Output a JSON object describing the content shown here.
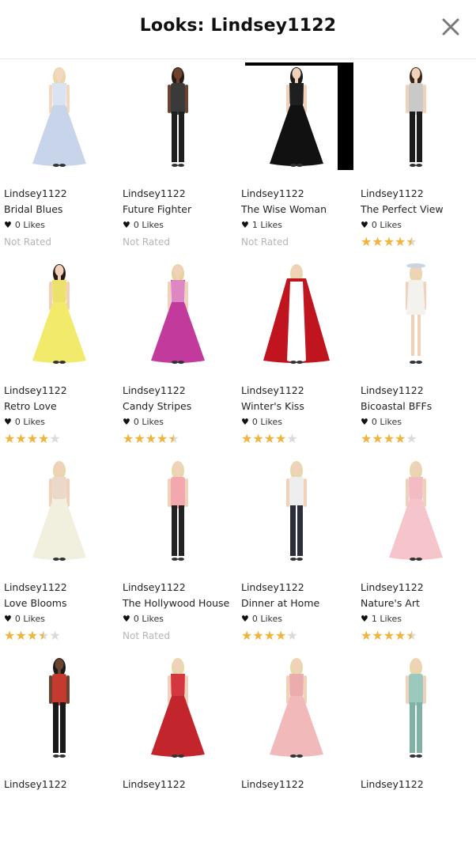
{
  "header": {
    "title": "Looks: Lindsey1122"
  },
  "looks": [
    {
      "user": "Lindsey1122",
      "name": "Bridal Blues",
      "likes": "0 Likes",
      "rating_text": "Not Rated",
      "stars": null,
      "outfit": {
        "dress": "#c8d4ea",
        "accent": "#e9eef8",
        "skin": "#f3d7c0",
        "hair": "#e9d8a6",
        "style": "gown"
      }
    },
    {
      "user": "Lindsey1122",
      "name": "Future Fighter",
      "likes": "0 Likes",
      "rating_text": "Not Rated",
      "stars": null,
      "outfit": {
        "dress": "#1f1f1f",
        "accent": "#3a3a3a",
        "skin": "#6b4330",
        "hair": "#2a1a12",
        "style": "pants"
      }
    },
    {
      "user": "Lindsey1122",
      "name": "The Wise Woman",
      "likes": "1 Likes",
      "rating_text": "Not Rated",
      "stars": null,
      "outfit": {
        "dress": "#111111",
        "accent": "#2b2b2b",
        "skin": "#f0d2bb",
        "hair": "#1b1b1b",
        "style": "gown"
      }
    },
    {
      "user": "Lindsey1122",
      "name": "The Perfect View",
      "likes": "0 Likes",
      "rating_text": "",
      "stars": 4.5,
      "outfit": {
        "dress": "#1c1c1c",
        "accent": "#c9c9c9",
        "skin": "#f0d2bb",
        "hair": "#3a2417",
        "style": "pants"
      }
    },
    {
      "user": "Lindsey1122",
      "name": "Retro Love",
      "likes": "0 Likes",
      "rating_text": "",
      "stars": 4,
      "outfit": {
        "dress": "#f2ea6a",
        "accent": "#e8d86a",
        "skin": "#f0d2bb",
        "hair": "#2a1a12",
        "style": "gown"
      }
    },
    {
      "user": "Lindsey1122",
      "name": "Candy Stripes",
      "likes": "0 Likes",
      "rating_text": "",
      "stars": 4.5,
      "outfit": {
        "dress": "#c23a9c",
        "accent": "#f4c6e4",
        "skin": "#f0d2bb",
        "hair": "#e7d29a",
        "style": "gown"
      }
    },
    {
      "user": "Lindsey1122",
      "name": "Winter's Kiss",
      "likes": "0 Likes",
      "rating_text": "",
      "stars": 4,
      "outfit": {
        "dress": "#ffffff",
        "accent": "#c0141e",
        "skin": "#f0d2bb",
        "hair": "#e8d7a8",
        "style": "cape"
      }
    },
    {
      "user": "Lindsey1122",
      "name": "Bicoastal BFFs",
      "likes": "0 Likes",
      "rating_text": "",
      "stars": 4,
      "outfit": {
        "dress": "#f4f2ef",
        "accent": "#d9d4cf",
        "skin": "#f0d2bb",
        "hair": "#e8d7a8",
        "style": "short"
      }
    },
    {
      "user": "Lindsey1122",
      "name": "Love Blooms",
      "likes": "0 Likes",
      "rating_text": "",
      "stars": 3.5,
      "outfit": {
        "dress": "#f1f0df",
        "accent": "#e3c4b6",
        "skin": "#f0d2bb",
        "hair": "#e8d7a8",
        "style": "gown"
      }
    },
    {
      "user": "Lindsey1122",
      "name": "The Hollywood House",
      "likes": "0 Likes",
      "rating_text": "Not Rated",
      "stars": null,
      "outfit": {
        "dress": "#222222",
        "accent": "#f3a7ae",
        "skin": "#f0d2bb",
        "hair": "#e8d7a8",
        "style": "pants"
      }
    },
    {
      "user": "Lindsey1122",
      "name": "Dinner at Home",
      "likes": "0 Likes",
      "rating_text": "",
      "stars": 4,
      "outfit": {
        "dress": "#2a2f3a",
        "accent": "#eeeeee",
        "skin": "#f0d2bb",
        "hair": "#e8d7a8",
        "style": "pants"
      }
    },
    {
      "user": "Lindsey1122",
      "name": "Nature's Art",
      "likes": "1 Likes",
      "rating_text": "",
      "stars": 4.5,
      "outfit": {
        "dress": "#f6c5cc",
        "accent": "#f1b2bb",
        "skin": "#f0d2bb",
        "hair": "#e8d7a8",
        "style": "gown"
      }
    },
    {
      "user": "Lindsey1122",
      "name": "",
      "likes": "",
      "rating_text": "",
      "stars": null,
      "outfit": {
        "dress": "#1a1a1a",
        "accent": "#c43a2f",
        "skin": "#6b4330",
        "hair": "#1a1a1a",
        "style": "pants"
      }
    },
    {
      "user": "Lindsey1122",
      "name": "",
      "likes": "",
      "rating_text": "",
      "stars": null,
      "outfit": {
        "dress": "#c3252d",
        "accent": "#e1474e",
        "skin": "#f0d2bb",
        "hair": "#e8d7a8",
        "style": "gown"
      }
    },
    {
      "user": "Lindsey1122",
      "name": "",
      "likes": "",
      "rating_text": "",
      "stars": null,
      "outfit": {
        "dress": "#f1b9b9",
        "accent": "#e6a2a6",
        "skin": "#f0d2bb",
        "hair": "#e8d7a8",
        "style": "gown"
      }
    },
    {
      "user": "Lindsey1122",
      "name": "",
      "likes": "",
      "rating_text": "",
      "stars": null,
      "outfit": {
        "dress": "#7fb2a4",
        "accent": "#9bc9bd",
        "skin": "#f0d2bb",
        "hair": "#e8d7a8",
        "style": "pants"
      }
    }
  ],
  "colors": {
    "star": "#f2b33d",
    "star_empty": "#dadada",
    "muted_text": "#b5b5b5"
  },
  "icons": {
    "close": "close-icon",
    "heart": "heart-icon",
    "star": "star-icon"
  }
}
